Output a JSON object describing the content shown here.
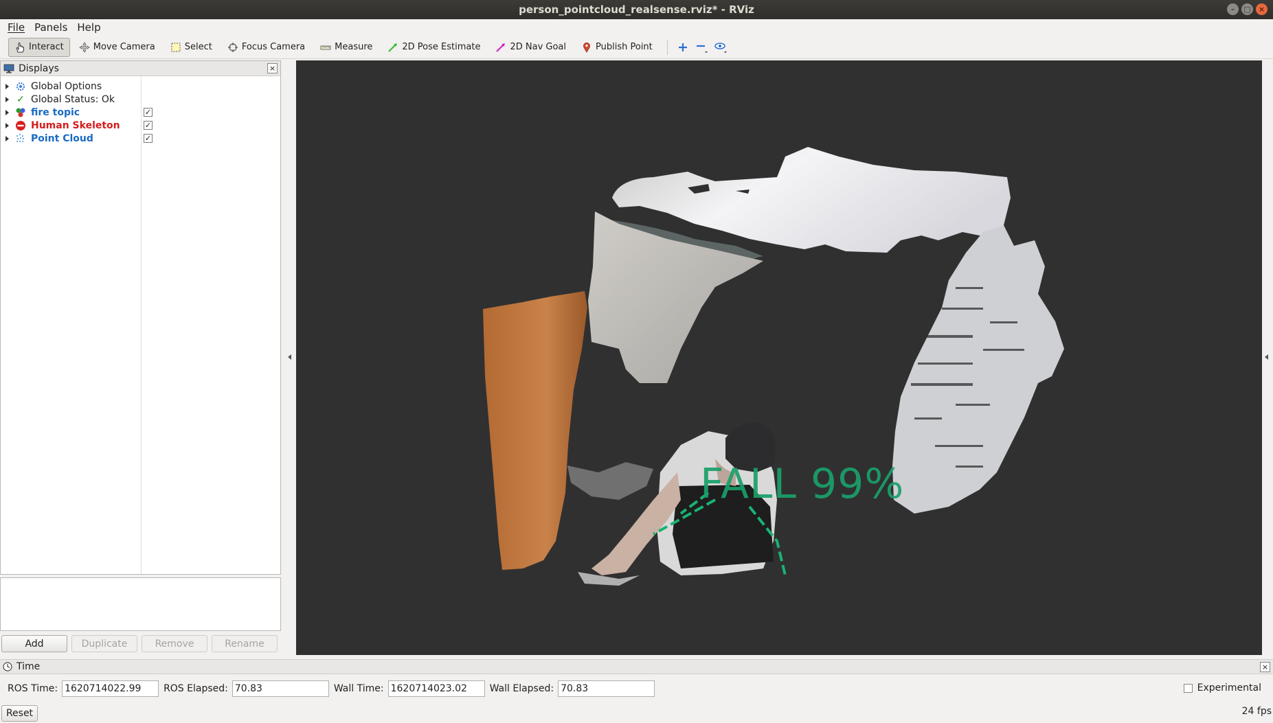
{
  "window": {
    "title": "person_pointcloud_realsense.rviz* - RViz",
    "controls": [
      "minimize",
      "maximize",
      "close"
    ]
  },
  "menu": {
    "items": [
      {
        "label": "File"
      },
      {
        "label": "Panels"
      },
      {
        "label": "Help"
      }
    ]
  },
  "toolbar": {
    "tools": [
      {
        "label": "Interact",
        "icon": "hand-icon",
        "active": true
      },
      {
        "label": "Move Camera",
        "icon": "move-camera-icon"
      },
      {
        "label": "Select",
        "icon": "select-box-icon"
      },
      {
        "label": "Focus Camera",
        "icon": "focus-camera-icon"
      },
      {
        "label": "Measure",
        "icon": "ruler-icon"
      },
      {
        "label": "2D Pose Estimate",
        "icon": "green-arrow-icon"
      },
      {
        "label": "2D Nav Goal",
        "icon": "magenta-arrow-icon"
      },
      {
        "label": "Publish Point",
        "icon": "map-pin-icon"
      }
    ],
    "extra_icons": [
      "add-tool-icon",
      "remove-tool-icon",
      "camera-view-icon"
    ]
  },
  "displays": {
    "title": "Displays",
    "items": [
      {
        "label": "Global Options",
        "icon": "gear-icon",
        "style": "normal"
      },
      {
        "label": "Global Status: Ok",
        "icon": "check-icon",
        "style": "normal"
      },
      {
        "label": "fire topic",
        "icon": "marker-icon",
        "style": "blue",
        "checked": true
      },
      {
        "label": "Human Skeleton",
        "icon": "error-icon",
        "style": "red",
        "checked": true
      },
      {
        "label": "Point Cloud",
        "icon": "point-cloud-icon",
        "style": "blue",
        "checked": true
      }
    ],
    "buttons": {
      "add": "Add",
      "duplicate": "Duplicate",
      "remove": "Remove",
      "rename": "Rename"
    }
  },
  "viewport": {
    "overlay_text": "FALL 99%",
    "overlay_color": "#1aa06a",
    "background": "#303030"
  },
  "time": {
    "title": "Time",
    "ros_time_label": "ROS Time:",
    "ros_time": "1620714022.99",
    "ros_elapsed_label": "ROS Elapsed:",
    "ros_elapsed": "70.83",
    "wall_time_label": "Wall Time:",
    "wall_time": "1620714023.02",
    "wall_elapsed_label": "Wall Elapsed:",
    "wall_elapsed": "70.83",
    "experimental_label": "Experimental",
    "reset_label": "Reset",
    "fps": "24 fps"
  }
}
